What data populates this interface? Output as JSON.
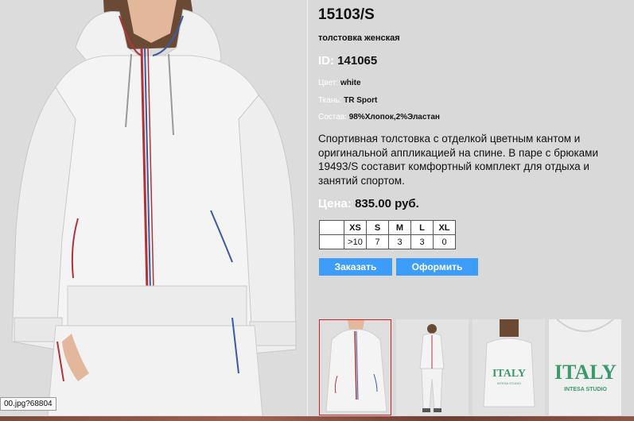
{
  "product": {
    "title": "15103/S",
    "subtitle": "толстовка женская",
    "id_label": "ID:",
    "id_value": "141065",
    "attributes": [
      {
        "label": "Цвет:",
        "value": "white"
      },
      {
        "label": "Ткань:",
        "value": "TR Sport"
      },
      {
        "label": "Состав:",
        "value": "98%Хлопок,2%Эластан"
      }
    ],
    "description": "Спортивная толстовка с отделкой цветным кантом и оригинальной аппликацией на спине. В паре с брюками 19493/S составит комфортный комплект для отдыха и занятий спортом.",
    "price_label": "Цена:",
    "price_value": "835.00 руб."
  },
  "sizes": {
    "headers": [
      "XS",
      "S",
      "M",
      "L",
      "XL"
    ],
    "quantities": [
      ">10",
      "7",
      "3",
      "3",
      "0"
    ]
  },
  "buttons": {
    "order": "Заказать",
    "checkout": "Оформить"
  },
  "status_url": "00.jpg?68804",
  "thumbnails": [
    {
      "name": "front-view",
      "selected": true
    },
    {
      "name": "full-body-front",
      "selected": false
    },
    {
      "name": "back-view",
      "selected": false
    },
    {
      "name": "back-applique-closeup",
      "selected": false
    }
  ],
  "applique": {
    "text": "ITALY",
    "subtext": "INTESA STUDIO"
  },
  "colors": {
    "background": "#d9d9d9",
    "button": "#3d9dfa",
    "selected_thumb_border": "#d12020",
    "trim_red": "#b0333a",
    "trim_blue": "#3c5aa0",
    "applique_green": "#3a9a6a"
  }
}
